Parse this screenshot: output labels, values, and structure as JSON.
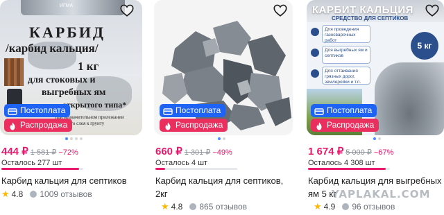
{
  "products": [
    {
      "favorite_icon": "heart-outline-icon",
      "image": {
        "line1": "КАРБИД",
        "line2": "/карбид кальция/",
        "line3": "1 кг",
        "line4": "для стоковых и",
        "line5": "выгребных ям",
        "line6": "открытого типа*",
        "fine_print_1": "*при незначительном прилежании",
        "fine_print_2": "верхнего слоя к грунту",
        "can_label": "ИГМА"
      },
      "badges": {
        "postpay": "Постоплата",
        "sale": "Распродажа"
      },
      "price": "444 ₽",
      "old_price": "1 581 ₽",
      "discount": "−72%",
      "stock_text": "Осталось 277 шт",
      "stock_level": 0.95,
      "title": "Карбид кальция для септиков",
      "rating": "4.8",
      "reviews": "1009 отзывов"
    },
    {
      "favorite_icon": "heart-outline-icon",
      "badges": {
        "postpay": "Постоплата",
        "sale": "Распродажа"
      },
      "price": "660 ₽",
      "old_price": "1 301 ₽",
      "discount": "−49%",
      "stock_text": "Осталось 4 шт",
      "stock_level": 0.12,
      "title_line1": "Карбид кальция для септиков,",
      "title_line2": "2кг",
      "rating": "4.8",
      "reviews": "865 отзывов"
    },
    {
      "favorite_icon": "heart-outline-icon",
      "image": {
        "title": "КАРБИТ КАЛЬЦИЯ",
        "subtitle": "СРЕДСТВО ДЛЯ СЕПТИКОВ",
        "tile1": "Для проведения газосварочных работ",
        "tile2": "Для выгребных ям и септиков",
        "tile3": "Для оттаивания грязных дорог, землеройки и т.п.",
        "weight": "5 кг"
      },
      "badges": {
        "postpay": "Постоплата",
        "sale": "Распродажа"
      },
      "price": "1 674 ₽",
      "old_price": "5 000 ₽",
      "discount": "−67%",
      "stock_text": "Осталось 4 308 шт",
      "stock_level": 0.95,
      "title_line1": "Карбид кальция для выгребных",
      "title_line2": "ям 5 кг",
      "rating": "4.9",
      "reviews": "96 отзывов"
    }
  ],
  "watermark": "YAPLAKAL.COM",
  "colors": {
    "accent": "#e8196c",
    "postpay": "#1e63f3",
    "sale": "#ea2f5f",
    "star": "#ffb800"
  }
}
